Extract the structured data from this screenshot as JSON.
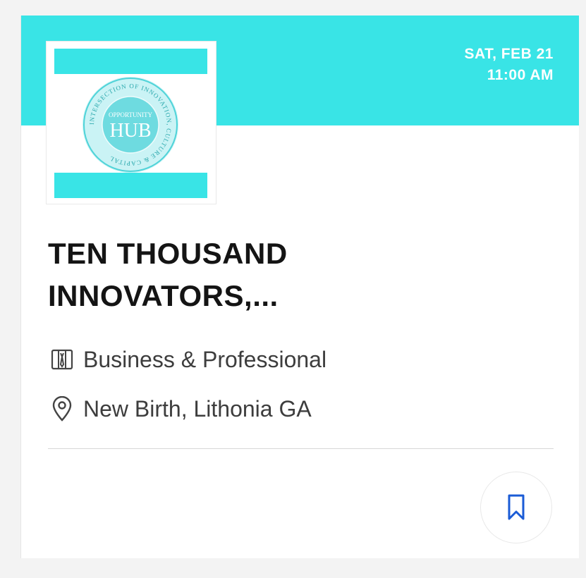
{
  "event": {
    "date": "SAT, FEB 21",
    "time": "11:00 AM",
    "title_line1": "TEN THOUSAND",
    "title_line2": "INNOVATORS,...",
    "category": "Business & Professional",
    "location": "New Birth, Lithonia GA"
  },
  "logo": {
    "center_top": "OPPORTUNITY",
    "center_main": "HUB",
    "ring_text": "INTERSECTION OF INNOVATION, CULTURE & CAPITAL"
  },
  "colors": {
    "accent": "#39e4e6",
    "save_icon": "#1a5bd6",
    "title": "#141414"
  },
  "icons": {
    "category": "briefcase-icon",
    "location": "map-pin-icon",
    "save": "bookmark-icon"
  }
}
